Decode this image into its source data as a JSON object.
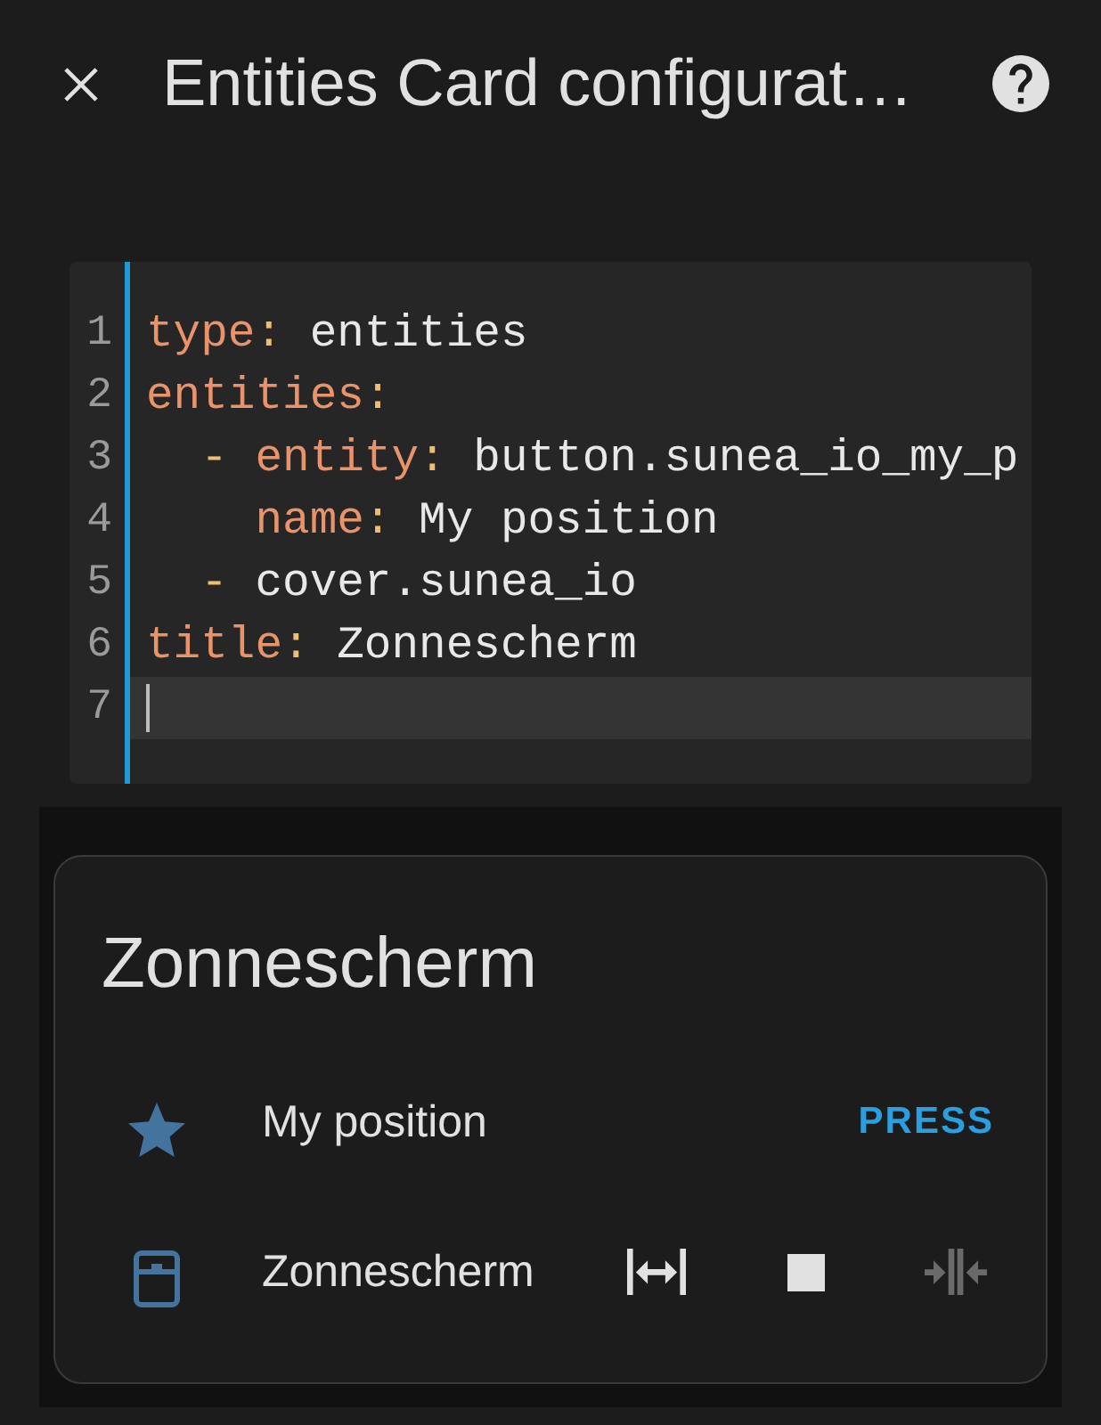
{
  "dialog": {
    "title": "Entities Card configurat…"
  },
  "editor": {
    "lines": [
      {
        "number": "1",
        "active": false,
        "tokens": [
          {
            "kind": "key",
            "text": "type"
          },
          {
            "kind": "punct",
            "text": ":"
          },
          {
            "kind": "value",
            "text": " entities"
          }
        ]
      },
      {
        "number": "2",
        "active": false,
        "tokens": [
          {
            "kind": "key",
            "text": "entities"
          },
          {
            "kind": "punct",
            "text": ":"
          }
        ]
      },
      {
        "number": "3",
        "active": false,
        "tokens": [
          {
            "kind": "punct",
            "text": "  -"
          },
          {
            "kind": "key",
            "text": " entity"
          },
          {
            "kind": "punct",
            "text": ":"
          },
          {
            "kind": "value",
            "text": " button.sunea_io_my_p"
          }
        ]
      },
      {
        "number": "4",
        "active": false,
        "tokens": [
          {
            "kind": "key",
            "text": "    name"
          },
          {
            "kind": "punct",
            "text": ":"
          },
          {
            "kind": "value",
            "text": " My position"
          }
        ]
      },
      {
        "number": "5",
        "active": false,
        "tokens": [
          {
            "kind": "punct",
            "text": "  -"
          },
          {
            "kind": "value",
            "text": " cover.sunea_io"
          }
        ]
      },
      {
        "number": "6",
        "active": false,
        "tokens": [
          {
            "kind": "key",
            "text": "title"
          },
          {
            "kind": "punct",
            "text": ":"
          },
          {
            "kind": "value",
            "text": " Zonnescherm"
          }
        ]
      },
      {
        "number": "7",
        "active": true
      }
    ]
  },
  "preview": {
    "card": {
      "title": "Zonnescherm",
      "rows": [
        {
          "kind": "button",
          "name": "My position",
          "action": "PRESS"
        },
        {
          "kind": "cover",
          "name": "Zonnescherm",
          "controls": [
            {
              "kind": "open",
              "disabled": false
            },
            {
              "kind": "stop",
              "disabled": false
            },
            {
              "kind": "close",
              "disabled": true
            }
          ]
        }
      ]
    }
  }
}
